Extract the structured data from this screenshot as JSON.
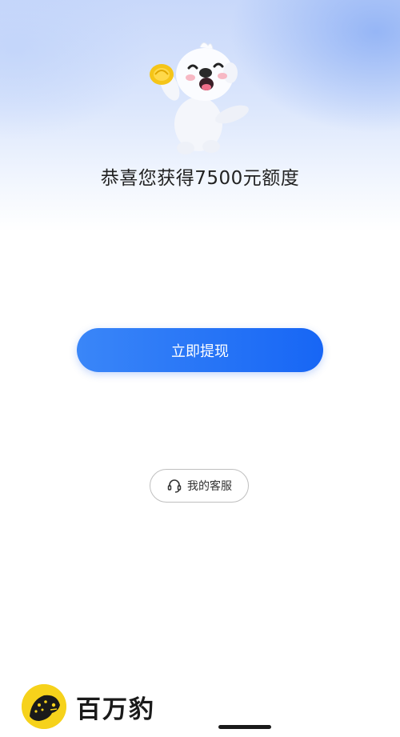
{
  "hero": {
    "mascot_icon": "mascot-holding-coin",
    "title": "恭喜您获得7500元额度"
  },
  "actions": {
    "withdraw_label": "立即提现",
    "service_label": "我的客服",
    "service_icon": "headset-icon"
  },
  "brand": {
    "logo_icon": "leopard-logo",
    "name": "百万豹"
  },
  "colors": {
    "primary": "#1f6ff6",
    "brand_yellow": "#f6d21b"
  }
}
